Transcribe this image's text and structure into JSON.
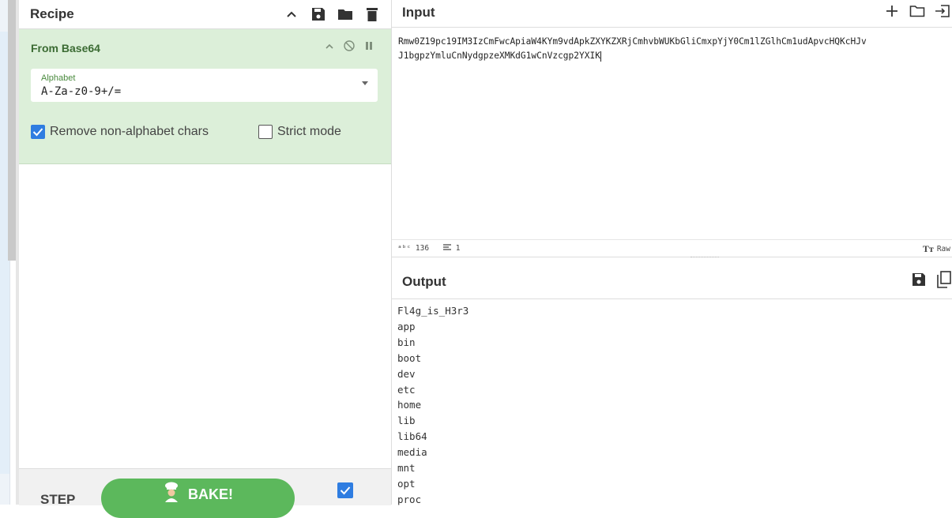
{
  "recipe": {
    "title": "Recipe",
    "header_icons": [
      "chevron-up-icon",
      "save-icon",
      "folder-icon",
      "trash-icon"
    ],
    "operation": {
      "title": "From Base64",
      "controls": [
        "chevron-up-icon",
        "disable-icon",
        "pause-icon"
      ],
      "alphabet_label": "Alphabet",
      "alphabet_value": "A-Za-z0-9+/=",
      "remove_non_alphabet": {
        "label": "Remove non-alphabet chars",
        "checked": true
      },
      "strict_mode": {
        "label": "Strict mode",
        "checked": false
      }
    },
    "step_label": "STEP",
    "bake_label": "BAKE!",
    "auto_bake_checked": true
  },
  "input": {
    "title": "Input",
    "icons": [
      "plus-icon",
      "folder-icon",
      "sign-in-icon"
    ],
    "lines": [
      "Rmw0Z19pc19IM3IzCmFwcApiaW4KYm9vdApkZXYKZXRjCmhvbWUKbGliCmxpYjY0Cm1lZGlhCm1udApvcHQKcHJv",
      "J1bgpzYmluCnNydgpzeXMKdG1wCnVzcgp2YXIK"
    ],
    "char_count": "136",
    "line_count": "1",
    "format_label": "Raw"
  },
  "output": {
    "title": "Output",
    "icons": [
      "save-icon",
      "copy-icon"
    ],
    "lines": [
      "Fl4g_is_H3r3",
      "app",
      "bin",
      "boot",
      "dev",
      "etc",
      "home",
      "lib",
      "lib64",
      "media",
      "mnt",
      "opt",
      "proc"
    ]
  },
  "colors": {
    "operation_bg": "#dcefd9",
    "operation_title": "#3b6b33",
    "bake_button": "#5cb85c",
    "checkbox_on": "#2f7de1"
  }
}
